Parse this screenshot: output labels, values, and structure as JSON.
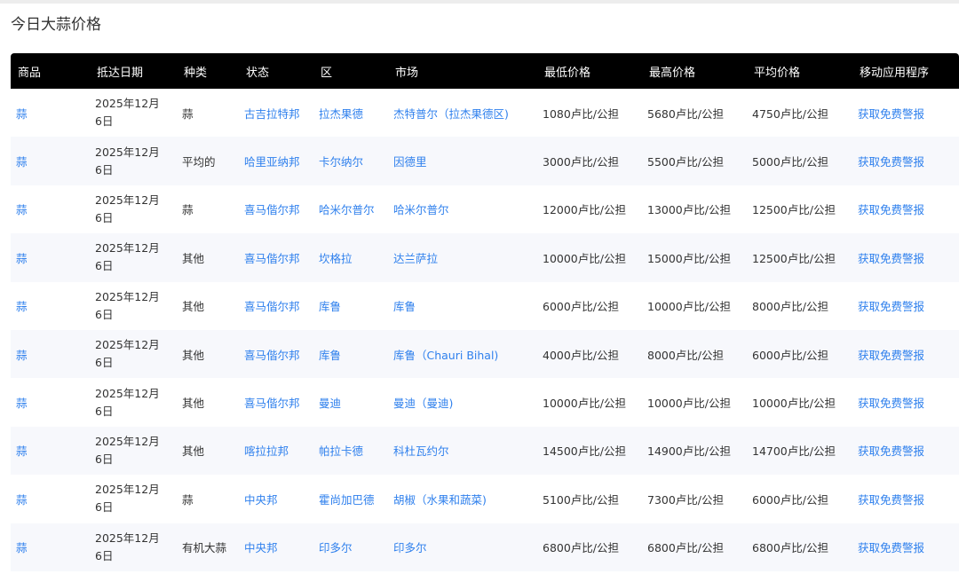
{
  "page": {
    "title": "今日大蒜价格"
  },
  "table": {
    "headers": [
      "商品",
      "抵达日期",
      "种类",
      "状态",
      "区",
      "市场",
      "最低价格",
      "最高价格",
      "平均价格",
      "移动应用程序"
    ],
    "rows": [
      {
        "commodity": "蒜",
        "date": "2025年12月6日",
        "variety": "蒜",
        "state": "古吉拉特邦",
        "district": "拉杰果德",
        "market": "杰特普尔（拉杰果德区)",
        "min": "1080卢比/公担",
        "max": "5680卢比/公担",
        "avg": "4750卢比/公担",
        "app": "获取免费警报"
      },
      {
        "commodity": "蒜",
        "date": "2025年12月6日",
        "variety": "平均的",
        "state": "哈里亚纳邦",
        "district": "卡尔纳尔",
        "market": "因德里",
        "min": "3000卢比/公担",
        "max": "5500卢比/公担",
        "avg": "5000卢比/公担",
        "app": "获取免费警报"
      },
      {
        "commodity": "蒜",
        "date": "2025年12月6日",
        "variety": "蒜",
        "state": "喜马偕尔邦",
        "district": "哈米尔普尔",
        "market": "哈米尔普尔",
        "min": "12000卢比/公担",
        "max": "13000卢比/公担",
        "avg": "12500卢比/公担",
        "app": "获取免费警报"
      },
      {
        "commodity": "蒜",
        "date": "2025年12月6日",
        "variety": "其他",
        "state": "喜马偕尔邦",
        "district": "坎格拉",
        "market": "达兰萨拉",
        "min": "10000卢比/公担",
        "max": "15000卢比/公担",
        "avg": "12500卢比/公担",
        "app": "获取免费警报"
      },
      {
        "commodity": "蒜",
        "date": "2025年12月6日",
        "variety": "其他",
        "state": "喜马偕尔邦",
        "district": "库鲁",
        "market": "库鲁",
        "min": "6000卢比/公担",
        "max": "10000卢比/公担",
        "avg": "8000卢比/公担",
        "app": "获取免费警报"
      },
      {
        "commodity": "蒜",
        "date": "2025年12月6日",
        "variety": "其他",
        "state": "喜马偕尔邦",
        "district": "库鲁",
        "market": "库鲁（Chauri Bihal)",
        "min": "4000卢比/公担",
        "max": "8000卢比/公担",
        "avg": "6000卢比/公担",
        "app": "获取免费警报"
      },
      {
        "commodity": "蒜",
        "date": "2025年12月6日",
        "variety": "其他",
        "state": "喜马偕尔邦",
        "district": "曼迪",
        "market": "曼迪（曼迪)",
        "min": "10000卢比/公担",
        "max": "10000卢比/公担",
        "avg": "10000卢比/公担",
        "app": "获取免费警报"
      },
      {
        "commodity": "蒜",
        "date": "2025年12月6日",
        "variety": "其他",
        "state": "喀拉拉邦",
        "district": "帕拉卡德",
        "market": "科杜瓦约尔",
        "min": "14500卢比/公担",
        "max": "14900卢比/公担",
        "avg": "14700卢比/公担",
        "app": "获取免费警报"
      },
      {
        "commodity": "蒜",
        "date": "2025年12月6日",
        "variety": "蒜",
        "state": "中央邦",
        "district": "霍尚加巴德",
        "market": "胡椒（水果和蔬菜)",
        "min": "5100卢比/公担",
        "max": "7300卢比/公担",
        "avg": "6000卢比/公担",
        "app": "获取免费警报"
      },
      {
        "commodity": "蒜",
        "date": "2025年12月6日",
        "variety": "有机大蒜",
        "state": "中央邦",
        "district": "印多尔",
        "market": "印多尔",
        "min": "6800卢比/公担",
        "max": "6800卢比/公担",
        "avg": "6800卢比/公担",
        "app": "获取免费警报"
      }
    ]
  },
  "colors": {
    "header_bg": "#000000",
    "header_text": "#ffffff",
    "link": "#2f80ed",
    "stripe": "#f7f8fc"
  }
}
